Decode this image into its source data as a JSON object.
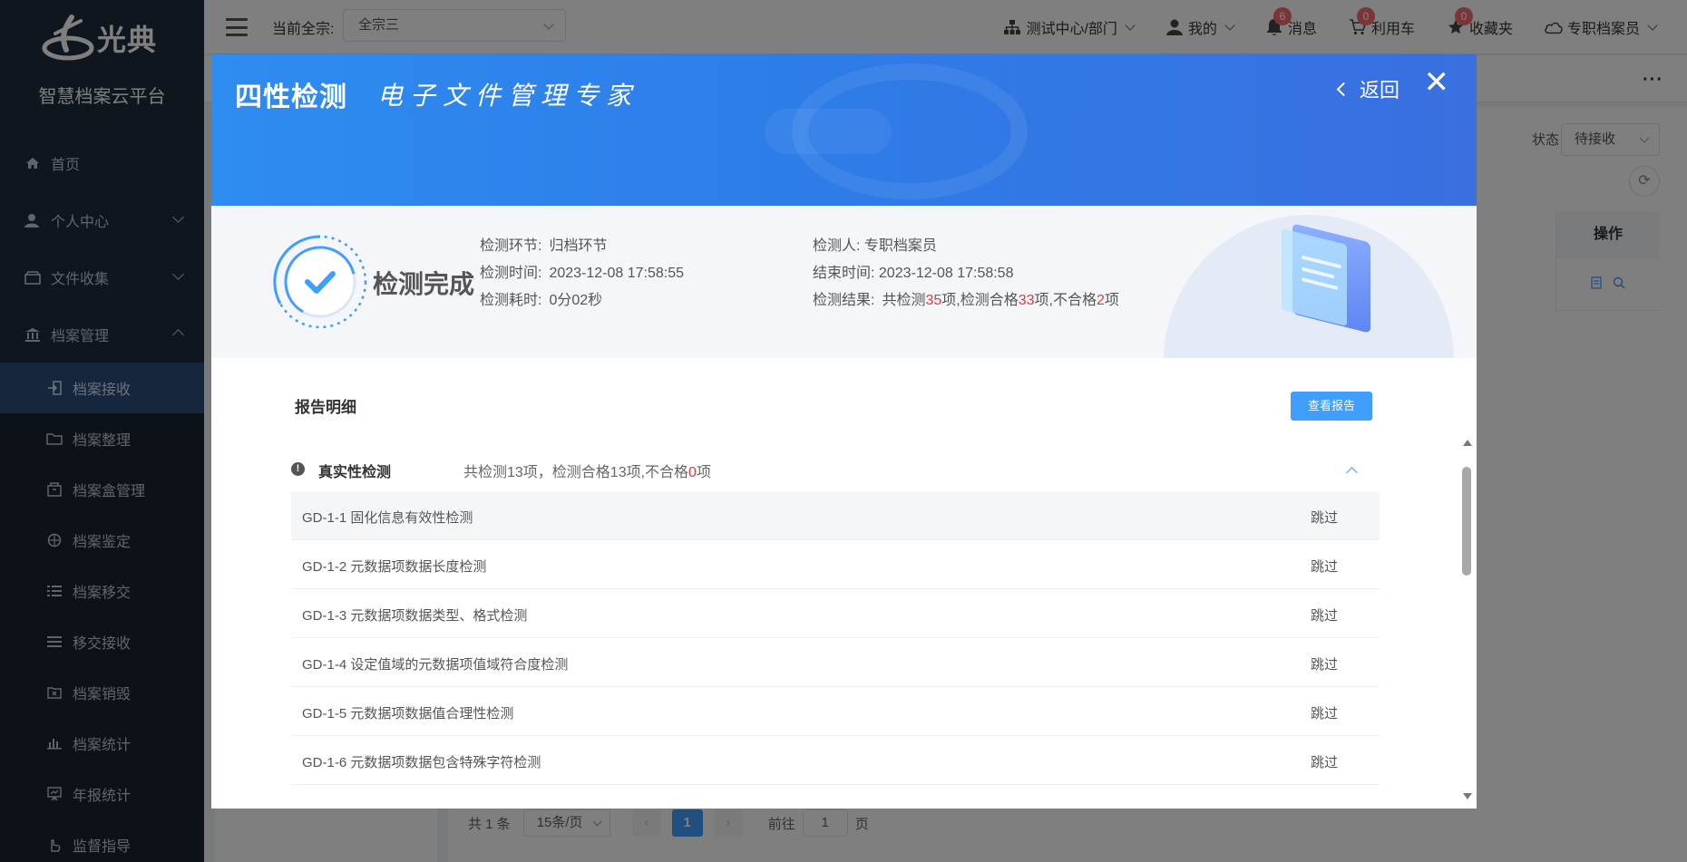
{
  "sidebar": {
    "logo_text": "光典",
    "platform_name": "智慧档案云平台",
    "items": [
      {
        "label": "首页",
        "icon": "home-icon"
      },
      {
        "label": "个人中心",
        "icon": "user-icon"
      },
      {
        "label": "文件收集",
        "icon": "inbox-icon"
      },
      {
        "label": "档案管理",
        "icon": "bank-icon"
      }
    ],
    "subitems": [
      {
        "label": "档案接收",
        "icon": "receive-icon"
      },
      {
        "label": "档案整理",
        "icon": "folder-icon"
      },
      {
        "label": "档案盒管理",
        "icon": "box-icon"
      },
      {
        "label": "档案鉴定",
        "icon": "compass-icon"
      },
      {
        "label": "档案移交",
        "icon": "list-icon"
      },
      {
        "label": "移交接收",
        "icon": "list-icon"
      },
      {
        "label": "档案销毁",
        "icon": "destroy-icon"
      },
      {
        "label": "档案统计",
        "icon": "bar-chart-icon"
      },
      {
        "label": "年报统计",
        "icon": "presentation-icon"
      },
      {
        "label": "监督指导",
        "icon": "hand-icon"
      }
    ]
  },
  "header": {
    "current_label": "当前全宗:",
    "current_value": "全宗三",
    "dept": "测试中心/部门",
    "mine": "我的",
    "messages": "消息",
    "messages_count": "6",
    "cart": "利用车",
    "cart_count": "0",
    "favorites": "收藏夹",
    "favorites_count": "0",
    "user": "专职档案员"
  },
  "page": {
    "status_label": "状态",
    "status_value": "待接收",
    "op_header": "操作",
    "pager": {
      "total": "共 1 条",
      "size": "15条/页",
      "current": "1",
      "goto_prefix": "前往",
      "goto_value": "1",
      "goto_suffix": "页"
    }
  },
  "modal": {
    "title": "四性检测",
    "slogan": "电子文件管理专家",
    "back": "返回",
    "status_text": "检测完成",
    "info": {
      "stage_label": "检测环节:",
      "stage_value": "归档环节",
      "time_label": "检测时间:",
      "time_value": "2023-12-08 17:58:55",
      "duration_label": "检测耗时:",
      "duration_value": "0分02秒",
      "inspector_label": "检测人:",
      "inspector_value": "专职档案员",
      "end_label": "结束时间:",
      "end_value": "2023-12-08 17:58:58",
      "result_label": "检测结果:",
      "result_total_prefix": "共检测",
      "result_total": "35",
      "result_pass_prefix": "项,检测合格",
      "result_pass": "33",
      "result_fail_prefix": "项,不合格",
      "result_fail": "2",
      "result_suffix": "项"
    },
    "detail_title": "报告明细",
    "report_button": "查看报告",
    "group": {
      "name": "真实性检测",
      "stat_prefix": "共检测13项，检测合格13项,不合格",
      "stat_fail": "0",
      "stat_suffix": "项"
    },
    "rows": [
      {
        "code": "GD-1-1 固化信息有效性检测",
        "result": "跳过"
      },
      {
        "code": "GD-1-2 元数据项数据长度检测",
        "result": "跳过"
      },
      {
        "code": "GD-1-3 元数据项数据类型、格式检测",
        "result": "跳过"
      },
      {
        "code": "GD-1-4 设定值域的元数据项值域符合度检测",
        "result": "跳过"
      },
      {
        "code": "GD-1-5 元数据项数据值合理性检测",
        "result": "跳过"
      },
      {
        "code": "GD-1-6 元数据项数据包含特殊字符检测",
        "result": "跳过"
      }
    ]
  },
  "colors": {
    "sidebar_bg": "#1f2d3d",
    "active_item": "#2d4c7a",
    "primary": "#409eff",
    "banner_start": "#2f8cf0",
    "banner_end": "#3a6fe0",
    "error": "#e4393c",
    "badge": "#f56c6c"
  }
}
